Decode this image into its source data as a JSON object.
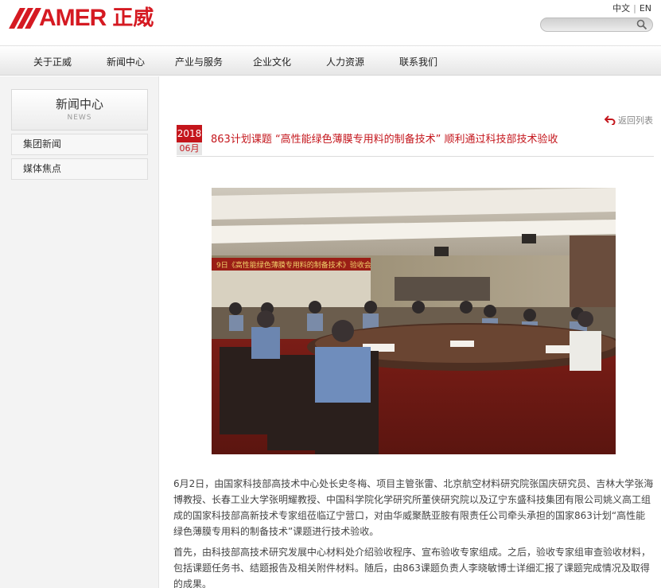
{
  "header": {
    "logo_text": "AMER",
    "logo_cn": "正威",
    "lang_cn": "中文",
    "lang_sep": "|",
    "lang_en": "EN",
    "search_placeholder": ""
  },
  "nav": {
    "items": [
      "关于正威",
      "新闻中心",
      "产业与服务",
      "企业文化",
      "人力资源",
      "联系我们"
    ]
  },
  "sidebar": {
    "title": "新闻中心",
    "subtitle": "NEWS",
    "items": [
      "集团新闻",
      "媒体焦点"
    ]
  },
  "article": {
    "back_label": "返回列表",
    "year": "2018",
    "month": "06月",
    "title": "863计划课题 “高性能绿色薄膜专用料的制备技术” 顺利通过科技部技术验收",
    "banner_text": "9日《高性能绿色薄膜专用料的制备技术》验收会",
    "paragraphs": [
      "6月2日，由国家科技部高技术中心处长史冬梅、项目主管张雷、北京航空材料研究院张国庆研究员、吉林大学张海博教授、长春工业大学张明耀教授、中国科学院化学研究所董侠研究院以及辽宁东盛科技集团有限公司姚义高工组成的国家科技部高新技术专家组莅临辽宁营口，对由华威聚酰亚胺有限责任公司牵头承担的国家863计划“高性能绿色薄膜专用料的制备技术”课题进行技术验收。",
      "首先，由科技部高技术研究发展中心材料处介绍验收程序、宣布验收专家组成。之后，验收专家组审查验收材料，包括课题任务书、结题报告及相关附件材料。随后，由863课题负责人李晓敏博士详细汇报了课题完成情况及取得的成果。"
    ]
  },
  "colors": {
    "brand_red": "#d51a22",
    "title_red": "#c4161c"
  },
  "icons": {
    "search": "search-icon",
    "back": "back-arrow-icon"
  }
}
